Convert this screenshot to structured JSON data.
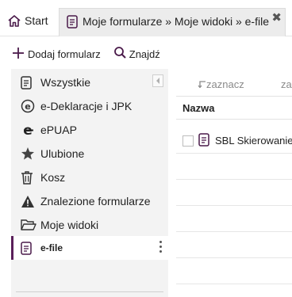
{
  "tabs": [
    {
      "label": "Start",
      "icon": "home-icon"
    },
    {
      "label": "Moje formularze » Moje widoki » e-file",
      "icon": "document-icon",
      "close": "✖"
    }
  ],
  "toolbar": {
    "add_label": "Dodaj formularz",
    "find_label": "Znajdź"
  },
  "sidebar": {
    "items": [
      {
        "label": "Wszystkie",
        "icon": "document-icon"
      },
      {
        "label": "e-Deklaracje i JPK",
        "icon": "e-deklaracje-icon"
      },
      {
        "label": "ePUAP",
        "icon": "epuap-icon"
      },
      {
        "label": "Ulubione",
        "icon": "star-icon"
      },
      {
        "label": "Kosz",
        "icon": "trash-icon"
      },
      {
        "label": "Znalezione formularze",
        "icon": "warning-icon"
      },
      {
        "label": "Moje widoki",
        "icon": "folder-open-icon"
      },
      {
        "label": "e-file",
        "icon": "document-icon",
        "active": true
      }
    ]
  },
  "table": {
    "actions": [
      "zaznacz",
      "za"
    ],
    "column_header": "Nazwa",
    "rows": [
      {
        "name": "SBL Skierowanie"
      }
    ]
  },
  "colors": {
    "accent": "#5a1f5a",
    "sidebar_bg": "#f3f3f3",
    "active_tab_bg": "#ececec"
  }
}
